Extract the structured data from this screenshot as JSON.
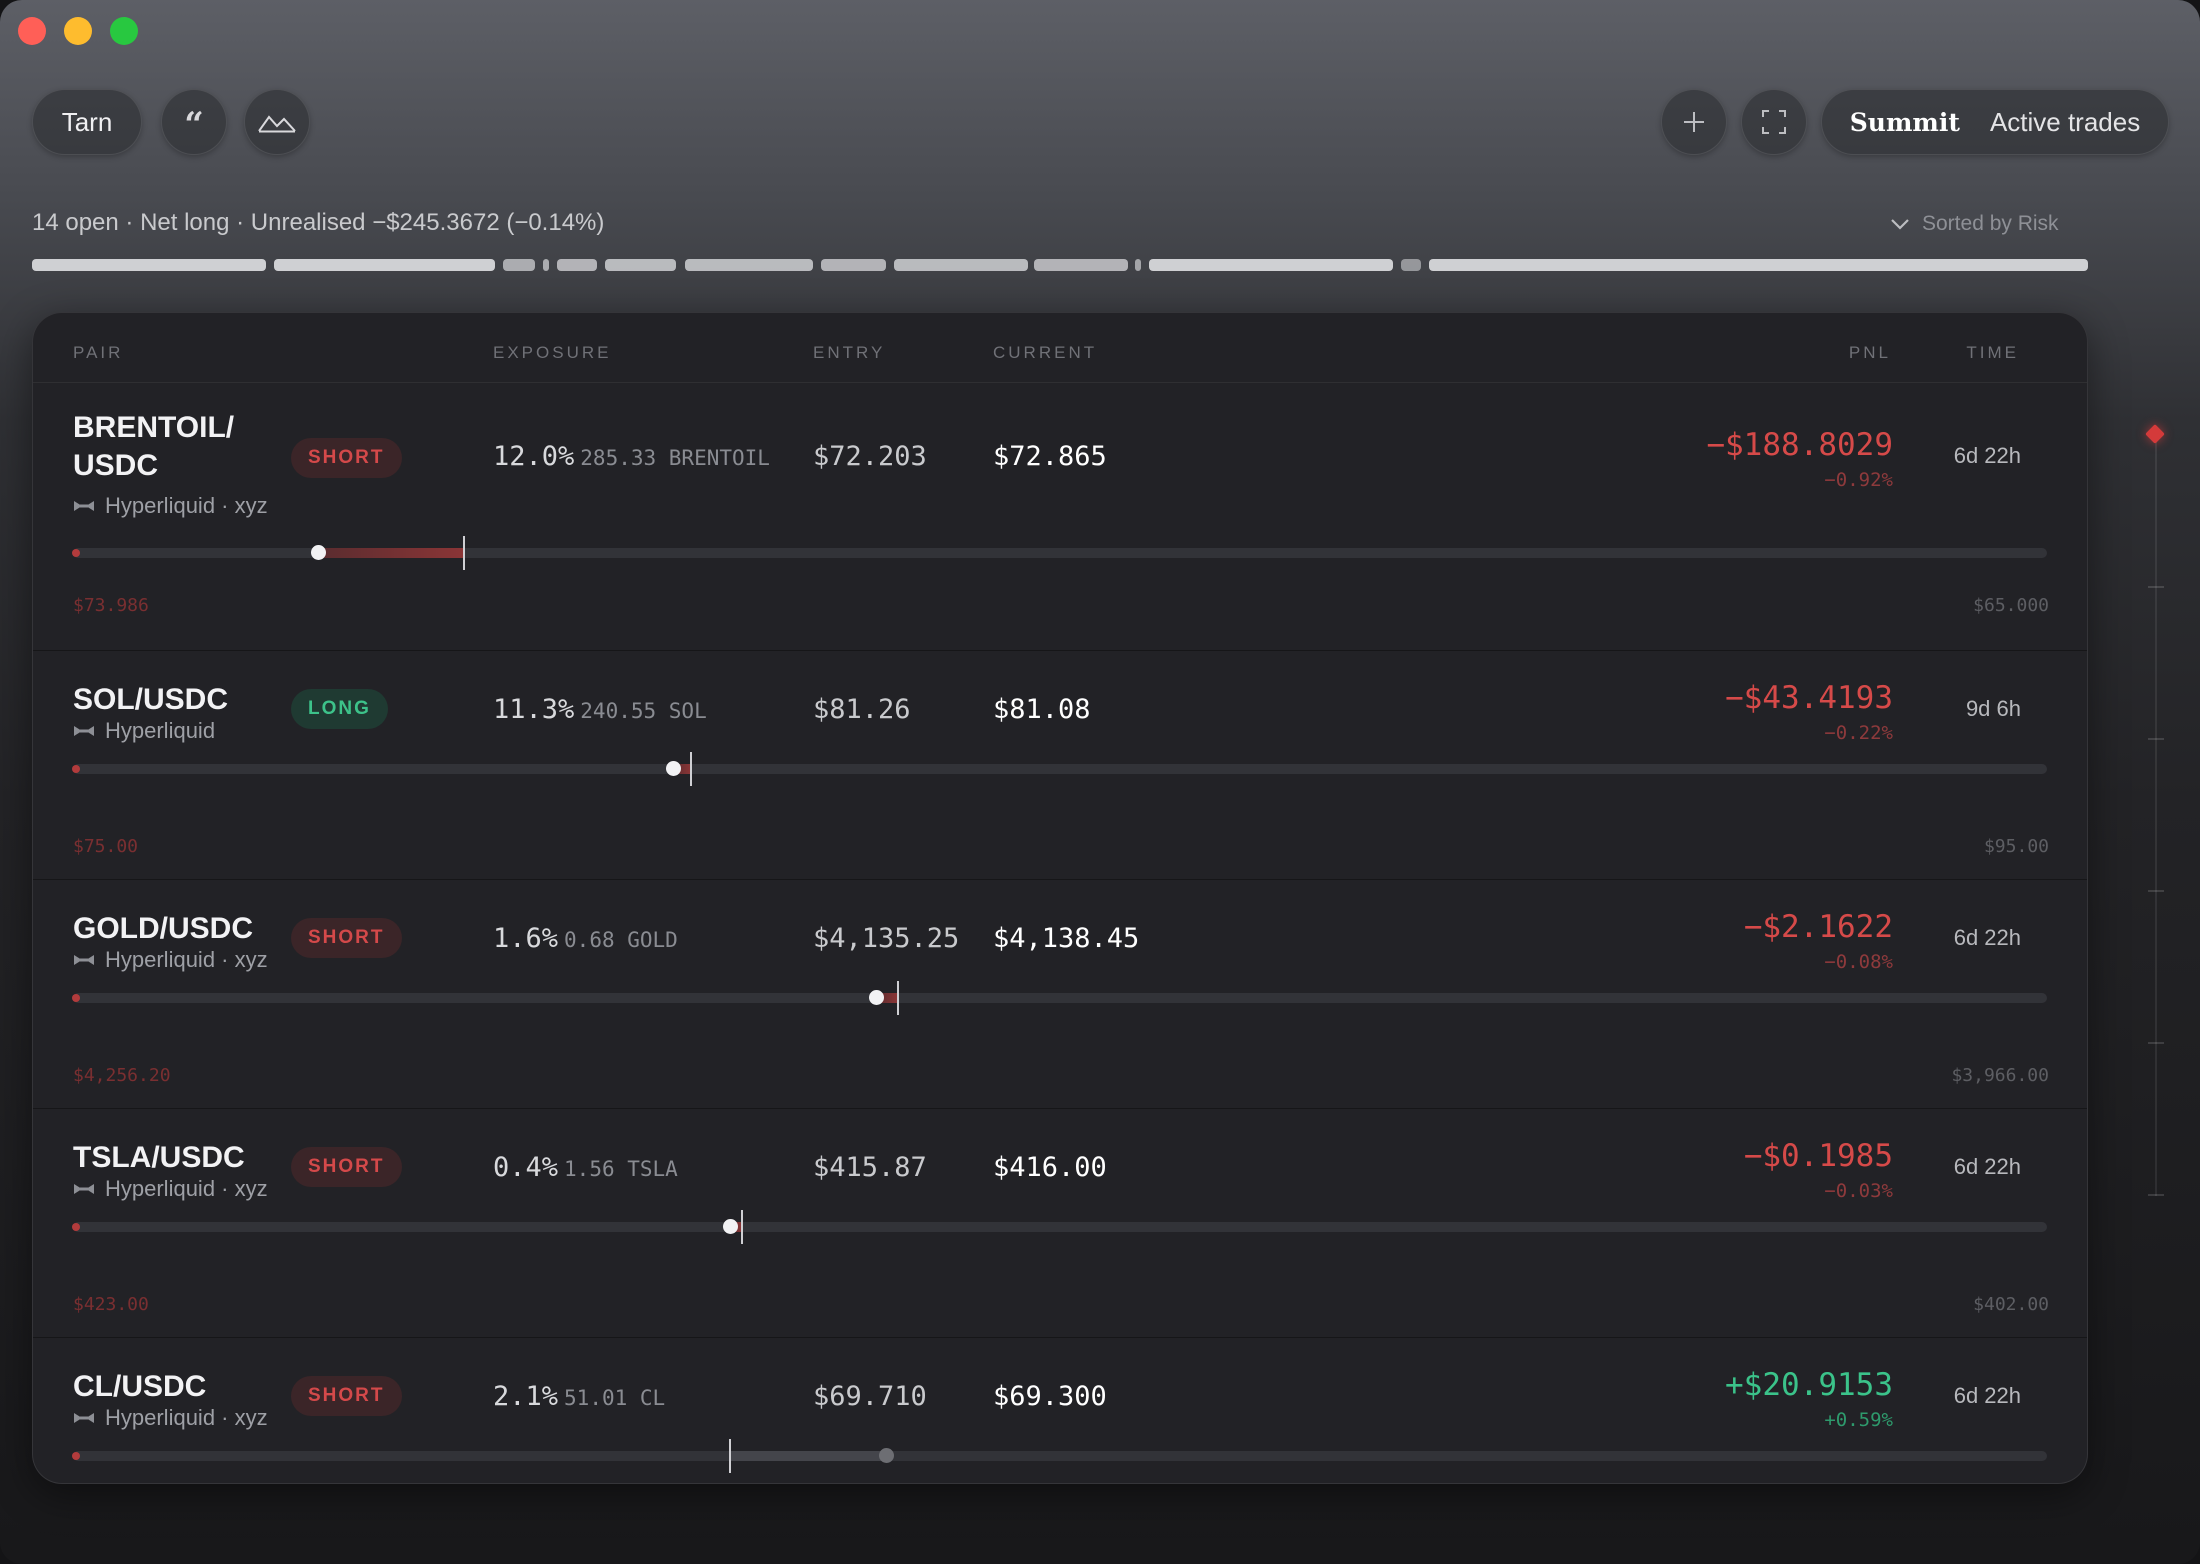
{
  "window": {
    "traffic_lights": {
      "close": "#ff5f57",
      "minimize": "#febc2e",
      "zoom": "#28c840"
    }
  },
  "toolbar": {
    "tarn_label": "Tarn",
    "quote_icon": "quote-icon",
    "mountain_icon": "mountain-icon",
    "add_icon": "plus-icon",
    "fullscreen_icon": "fullscreen-icon",
    "brand": "Summit",
    "section": "Active trades"
  },
  "summary": {
    "text": "14 open · Net long · Unrealised −$245.3672 (−0.14%)",
    "sort_label": "Sorted by Risk"
  },
  "table": {
    "headers": {
      "pair": "PAIR",
      "exposure": "EXPOSURE",
      "entry": "ENTRY",
      "current": "CURRENT",
      "pnl": "PNL",
      "time": "TIME"
    },
    "rows": [
      {
        "pair_line1": "BRENTOIL/",
        "pair_line2": "USDC",
        "venue": "Hyperliquid · xyz",
        "side": "SHORT",
        "exposure_pct": "12.0%",
        "exposure_qty": "285.33 BRENTOIL",
        "entry": "$72.203",
        "current": "$72.865",
        "pnl": "−$188.8029",
        "pnl_pct": "−0.92%",
        "time": "6d 22h",
        "range_low": "$73.986",
        "range_high": "$65.000",
        "pnl_sign": "neg",
        "entry_frac": 0.198,
        "current_frac": 0.124
      },
      {
        "pair_line1": "SOL/USDC",
        "pair_line2": "",
        "venue": "Hyperliquid",
        "side": "LONG",
        "exposure_pct": "11.3%",
        "exposure_qty": "240.55 SOL",
        "entry": "$81.26",
        "current": "$81.08",
        "pnl": "−$43.4193",
        "pnl_pct": "−0.22%",
        "time": "9d 6h",
        "range_low": "$75.00",
        "range_high": "$95.00",
        "pnl_sign": "neg",
        "entry_frac": 0.313,
        "current_frac": 0.304
      },
      {
        "pair_line1": "GOLD/USDC",
        "pair_line2": "",
        "venue": "Hyperliquid · xyz",
        "side": "SHORT",
        "exposure_pct": "1.6%",
        "exposure_qty": "0.68 GOLD",
        "entry": "$4,135.25",
        "current": "$4,138.45",
        "pnl": "−$2.1622",
        "pnl_pct": "−0.08%",
        "time": "6d 22h",
        "range_low": "$4,256.20",
        "range_high": "$3,966.00",
        "pnl_sign": "neg",
        "entry_frac": 0.418,
        "current_frac": 0.407
      },
      {
        "pair_line1": "TSLA/USDC",
        "pair_line2": "",
        "venue": "Hyperliquid · xyz",
        "side": "SHORT",
        "exposure_pct": "0.4%",
        "exposure_qty": "1.56 TSLA",
        "entry": "$415.87",
        "current": "$416.00",
        "pnl": "−$0.1985",
        "pnl_pct": "−0.03%",
        "time": "6d 22h",
        "range_low": "$423.00",
        "range_high": "$402.00",
        "pnl_sign": "neg",
        "entry_frac": 0.339,
        "current_frac": 0.333
      },
      {
        "pair_line1": "CL/USDC",
        "pair_line2": "",
        "venue": "Hyperliquid · xyz",
        "side": "SHORT",
        "exposure_pct": "2.1%",
        "exposure_qty": "51.01 CL",
        "entry": "$69.710",
        "current": "$69.300",
        "pnl": "+$20.9153",
        "pnl_pct": "+0.59%",
        "time": "6d 22h",
        "range_low": "",
        "range_high": "",
        "pnl_sign": "pos",
        "entry_frac": 0.333,
        "current_frac": 0.412
      }
    ]
  },
  "colors": {
    "negative": "#d64a49",
    "positive": "#3bc38a",
    "short_badge": "#d4494a",
    "long_badge": "#3dc28a",
    "risk_marker": "#d43a3a"
  }
}
